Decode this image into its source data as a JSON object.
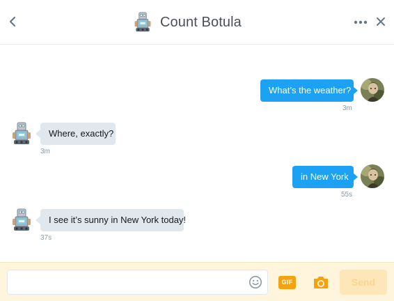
{
  "header": {
    "title": "Count Botula",
    "back_icon": "chevron-left-icon",
    "more_icon": "more-horizontal-icon",
    "close_icon": "close-icon"
  },
  "messages": [
    {
      "direction": "outgoing",
      "text": "What’s the weather?",
      "time": "3m"
    },
    {
      "direction": "incoming",
      "text": "Where, exactly?",
      "time": "3m"
    },
    {
      "direction": "outgoing",
      "text": "in New York",
      "time": "55s"
    },
    {
      "direction": "incoming",
      "text": "I see it’s sunny in New York today!",
      "time": "37s"
    }
  ],
  "composer": {
    "input_value": "",
    "input_placeholder": "",
    "emoji_icon": "emoji-icon",
    "gif_label": "GIF",
    "camera_icon": "camera-icon",
    "send_label": "Send"
  },
  "colors": {
    "outgoing_bubble": "#1da1f2",
    "incoming_bubble": "#e1e8ed",
    "composer_bg": "#fff5dc",
    "accent": "#f2a30f",
    "send_disabled_bg": "#fde7b8"
  }
}
